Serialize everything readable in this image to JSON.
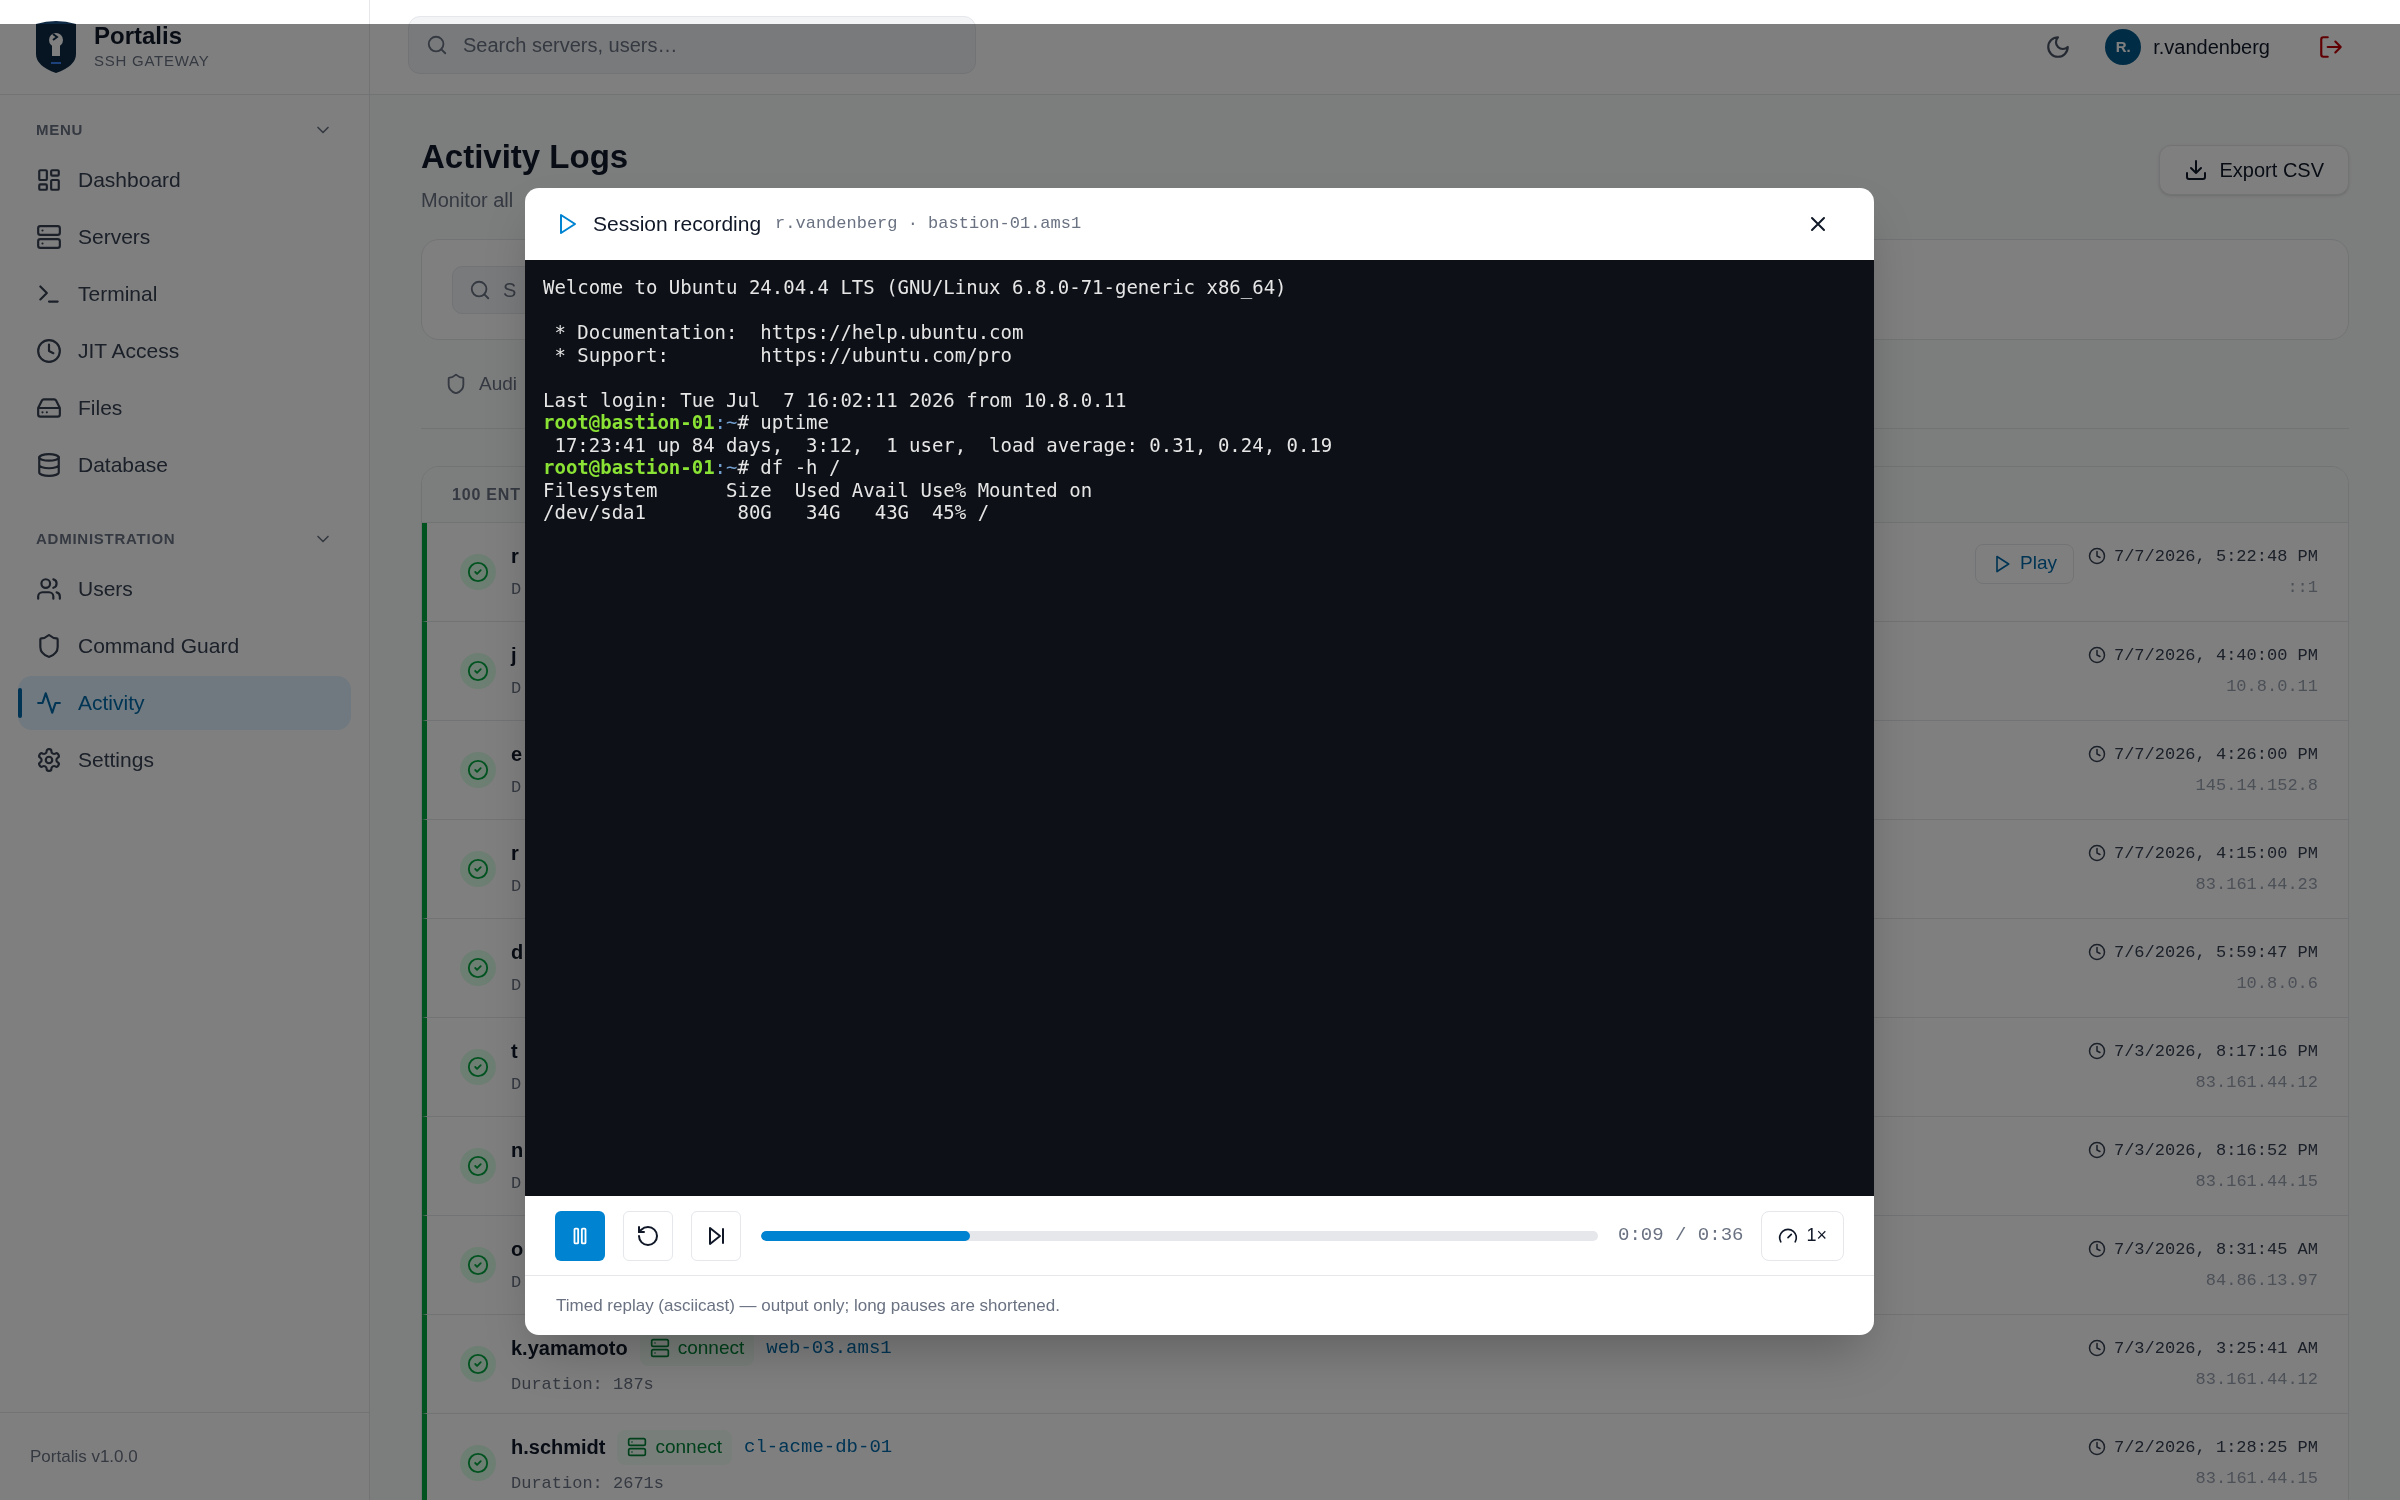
{
  "brand": {
    "name": "Portalis",
    "tagline": "SSH GATEWAY"
  },
  "sidebar": {
    "sections": [
      {
        "title": "MENU",
        "expanded": true,
        "items": [
          {
            "label": "Dashboard",
            "selected": false
          },
          {
            "label": "Servers",
            "selected": false
          },
          {
            "label": "Terminal",
            "selected": false
          },
          {
            "label": "JIT Access",
            "selected": false
          },
          {
            "label": "Files",
            "selected": false
          },
          {
            "label": "Database",
            "selected": false
          }
        ]
      },
      {
        "title": "ADMINISTRATION",
        "expanded": true,
        "items": [
          {
            "label": "Users",
            "selected": false
          },
          {
            "label": "Command Guard",
            "selected": false
          },
          {
            "label": "Activity",
            "selected": true
          },
          {
            "label": "Settings",
            "selected": false
          }
        ]
      }
    ],
    "footer": "Portalis v1.0.0"
  },
  "header": {
    "search_placeholder": "Search servers, users…",
    "user": {
      "initials": "R.",
      "name": "r.vandenberg"
    }
  },
  "page": {
    "title": "Activity Logs",
    "subtitle": "Monitor all",
    "export_button": "Export CSV",
    "filter_search": "S",
    "tab": "Audi",
    "entries_label": "100 ENT"
  },
  "entries": [
    {
      "user": "r",
      "detail": "D",
      "play_button": "Play",
      "time": "7/7/2026, 5:22:48 PM",
      "ip": "::1"
    },
    {
      "user": "j",
      "detail": "D",
      "time": "7/7/2026, 4:40:00 PM",
      "ip": "10.8.0.11"
    },
    {
      "user": "e",
      "detail": "D",
      "time": "7/7/2026, 4:26:00 PM",
      "ip": "145.14.152.8"
    },
    {
      "user": "r",
      "detail": "D",
      "time": "7/7/2026, 4:15:00 PM",
      "ip": "83.161.44.23"
    },
    {
      "user": "d",
      "detail": "D",
      "time": "7/6/2026, 5:59:47 PM",
      "ip": "10.8.0.6"
    },
    {
      "user": "t",
      "detail": "D",
      "time": "7/3/2026, 8:17:16 PM",
      "ip": "83.161.44.12"
    },
    {
      "user": "n",
      "detail": "D",
      "time": "7/3/2026, 8:16:52 PM",
      "ip": "83.161.44.15"
    },
    {
      "user": "o",
      "detail": "D",
      "time": "7/3/2026, 8:31:45 AM",
      "ip": "84.86.13.97"
    },
    {
      "user": "k.yamamoto",
      "action": "connect",
      "host": "web-03.ams1",
      "detail": "Duration: 187s",
      "time": "7/3/2026, 3:25:41 AM",
      "ip": "83.161.44.12"
    },
    {
      "user": "h.schmidt",
      "action": "connect",
      "host": "cl-acme-db-01",
      "detail": "Duration: 2671s",
      "time": "7/2/2026, 1:28:25 PM",
      "ip": "83.161.44.15"
    }
  ],
  "modal": {
    "title": "Session recording",
    "meta": "r.vandenberg · bastion-01.ams1",
    "terminal": [
      {
        "kind": "output",
        "text": "Welcome to Ubuntu 24.04.4 LTS (GNU/Linux 6.8.0-71-generic x86_64)"
      },
      {
        "kind": "blank"
      },
      {
        "kind": "output",
        "text": " * Documentation:  https://help.ubuntu.com"
      },
      {
        "kind": "output",
        "text": " * Support:        https://ubuntu.com/pro"
      },
      {
        "kind": "blank"
      },
      {
        "kind": "output",
        "text": "Last login: Tue Jul  7 16:02:11 2026 from 10.8.0.11"
      },
      {
        "kind": "prompt",
        "host": "root@bastion-01",
        "path": ":~",
        "command": "# uptime"
      },
      {
        "kind": "output",
        "text": " 17:23:41 up 84 days,  3:12,  1 user,  load average: 0.31, 0.24, 0.19"
      },
      {
        "kind": "prompt",
        "host": "root@bastion-01",
        "path": ":~",
        "command": "# df -h /"
      },
      {
        "kind": "output",
        "text": "Filesystem      Size  Used Avail Use% Mounted on"
      },
      {
        "kind": "output",
        "text": "/dev/sda1        80G   34G   43G  45% /"
      }
    ],
    "player": {
      "playing": true,
      "level": 0.25,
      "time": "0:09 / 0:36",
      "speed": "1×"
    },
    "note": "Timed replay (asciicast) — output only; long pauses are shortened."
  }
}
